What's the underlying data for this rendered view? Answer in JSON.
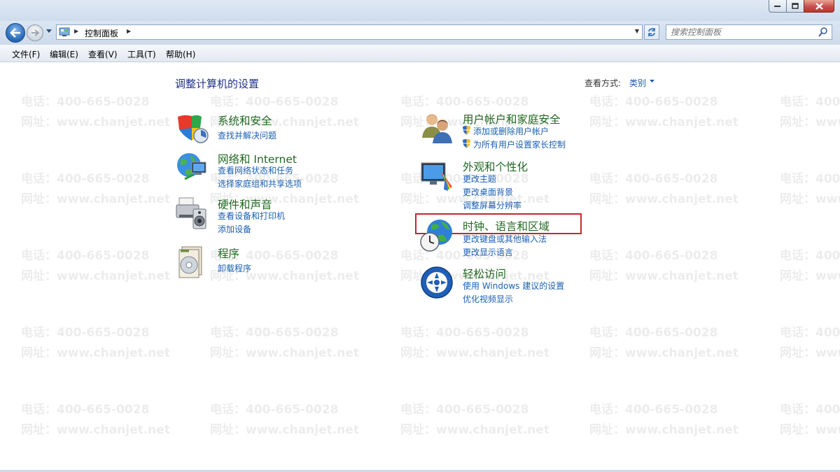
{
  "window": {
    "minimize_icon": "minimize-icon",
    "maximize_icon": "maximize-icon",
    "close_icon": "close-icon"
  },
  "address_bar": {
    "breadcrumb": "控制面板",
    "search_placeholder": "搜索控制面板"
  },
  "menu": [
    "文件(F)",
    "编辑(E)",
    "查看(V)",
    "工具(T)",
    "帮助(H)"
  ],
  "content": {
    "title": "调整计算机的设置",
    "view_by_label": "查看方式:",
    "view_by_value": "类别"
  },
  "categories": [
    {
      "title": "系统和安全",
      "links": [
        "查找并解决问题"
      ],
      "icon": "system-security-icon"
    },
    {
      "title": "网络和 Internet",
      "links": [
        "查看网络状态和任务",
        "选择家庭组和共享选项"
      ],
      "icon": "network-icon"
    },
    {
      "title": "硬件和声音",
      "links": [
        "查看设备和打印机",
        "添加设备"
      ],
      "icon": "hardware-sound-icon"
    },
    {
      "title": "程序",
      "links": [
        "卸载程序"
      ],
      "icon": "programs-icon"
    },
    {
      "title": "用户帐户和家庭安全",
      "links": [
        "添加或删除用户帐户",
        "为所有用户设置家长控制"
      ],
      "icon": "user-accounts-icon"
    },
    {
      "title": "外观和个性化",
      "links": [
        "更改主题",
        "更改桌面背景",
        "调整屏幕分辨率"
      ],
      "icon": "appearance-icon"
    },
    {
      "title": "时钟、语言和区域",
      "links": [
        "更改键盘或其他输入法",
        "更改显示语言"
      ],
      "icon": "clock-region-icon"
    },
    {
      "title": "轻松访问",
      "links": [
        "使用 Windows 建议的设置",
        "优化视频显示"
      ],
      "icon": "ease-of-access-icon"
    }
  ],
  "watermark": {
    "phone": "电话：400-665-0028",
    "site": "网址：www.chanjet.net"
  },
  "colors": {
    "category_title": "#216821",
    "link": "#1b5fb2",
    "page_title": "#1e3287",
    "highlight": "#c8252e"
  }
}
